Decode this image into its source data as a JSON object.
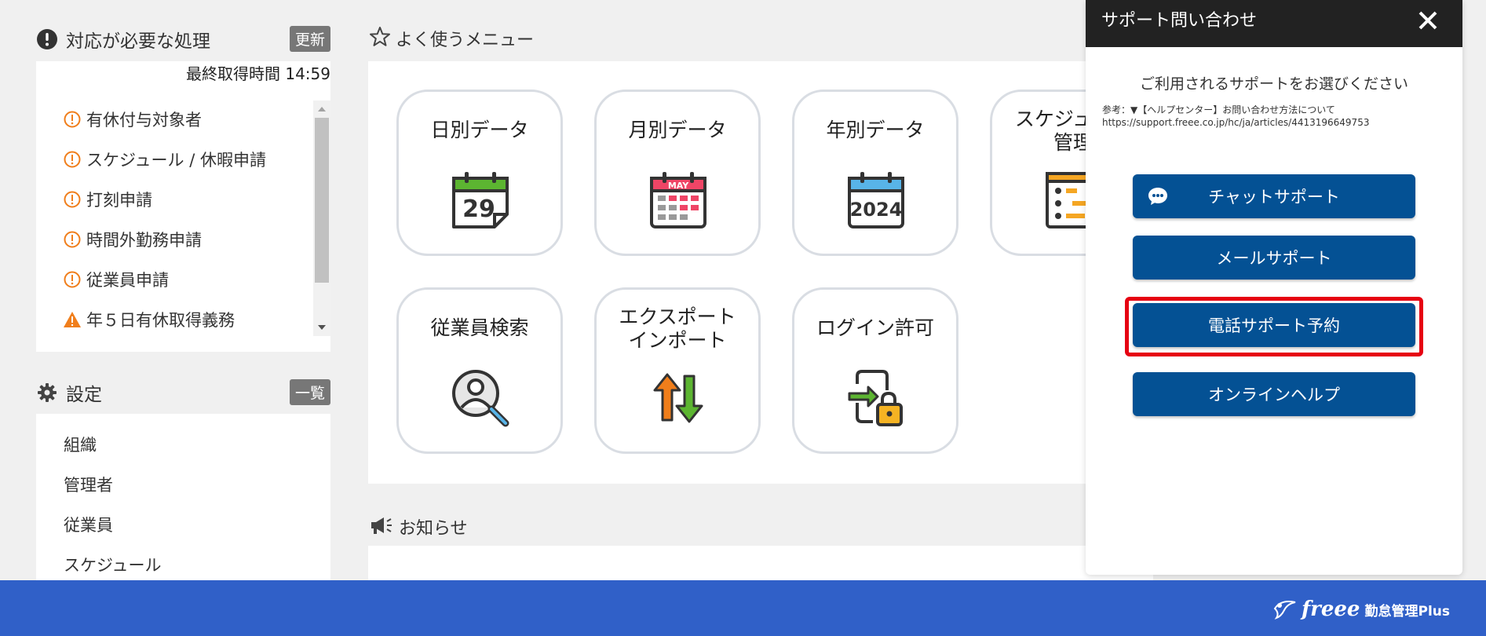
{
  "alerts": {
    "title": "対応が必要な処理",
    "refresh_label": "更新",
    "last_fetch_label": "最終取得時間",
    "last_fetch_time": "14:59",
    "items": [
      {
        "label": "有休付与対象者",
        "icon": "exclamation-circle-icon"
      },
      {
        "label": "スケジュール / 休暇申請",
        "icon": "exclamation-circle-icon"
      },
      {
        "label": "打刻申請",
        "icon": "exclamation-circle-icon"
      },
      {
        "label": "時間外勤務申請",
        "icon": "exclamation-circle-icon"
      },
      {
        "label": "従業員申請",
        "icon": "exclamation-circle-icon"
      },
      {
        "label": "年５日有休取得義務",
        "icon": "warning-triangle-icon"
      }
    ]
  },
  "settings": {
    "title": "設定",
    "list_label": "一覧",
    "items": [
      "組織",
      "管理者",
      "従業員",
      "スケジュール"
    ]
  },
  "menu": {
    "title": "よく使うメニュー",
    "tiles": [
      {
        "label": "日別データ",
        "icon": "daily-calendar-icon",
        "day": "29"
      },
      {
        "label": "月別データ",
        "icon": "monthly-calendar-icon",
        "month": "MAY"
      },
      {
        "label": "年別データ",
        "icon": "yearly-calendar-icon",
        "year": "2024"
      },
      {
        "label": "スケジュール\n管理",
        "icon": "schedule-icon"
      },
      {
        "label": "従業員検索",
        "icon": "employee-search-icon"
      },
      {
        "label": "エクスポート\nインポート",
        "icon": "export-import-icon"
      },
      {
        "label": "ログイン許可",
        "icon": "login-permission-icon"
      }
    ]
  },
  "news": {
    "title": "お知らせ"
  },
  "support_modal": {
    "title": "サポート問い合わせ",
    "prompt": "ご利用されるサポートをお選びください",
    "note_line1": "参考：▼【ヘルプセンター】お問い合わせ方法について",
    "note_line2": "https://support.freee.co.jp/hc/ja/articles/4413196649753",
    "buttons": {
      "chat": "チャットサポート",
      "mail": "メールサポート",
      "phone": "電話サポート予約",
      "help": "オンラインヘルプ"
    }
  },
  "footer": {
    "brand_name": "freee",
    "product_name": "勤怠管理Plus"
  },
  "colors": {
    "primary_button": "#045194",
    "highlight": "#e60012",
    "footer": "#3060c8",
    "alert_orange": "#f07e1b"
  }
}
